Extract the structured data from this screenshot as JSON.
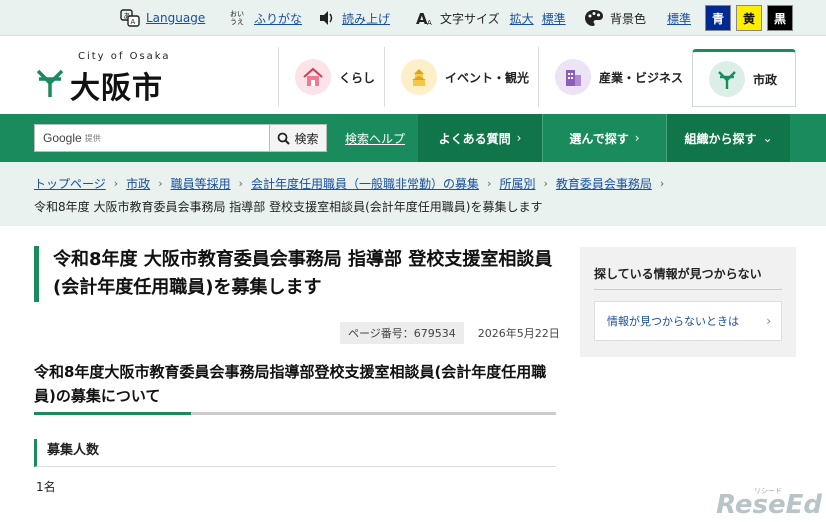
{
  "utility": {
    "language": "Language",
    "furigana_icon_text": "おいうえ",
    "furigana": "ふりがな",
    "read_aloud": "読み上げ",
    "font_size_label": "文字サイズ",
    "font_enlarge": "拡大",
    "font_standard": "標準",
    "bg_color_label": "背景色",
    "bg_standard": "標準",
    "bg_blue": "青",
    "bg_yellow": "黄",
    "bg_black": "黒"
  },
  "header": {
    "logo_small": "City of Osaka",
    "logo_name": "大阪市",
    "categories": [
      {
        "label": "くらし"
      },
      {
        "label": "イベント・観光"
      },
      {
        "label": "産業・ビジネス"
      },
      {
        "label": "市政"
      }
    ]
  },
  "nav": {
    "search_brand": "Google",
    "search_brand_sub": "提供",
    "search_button": "検索",
    "search_help": "検索ヘルプ",
    "tabs": [
      {
        "label": "よくある質問",
        "arrow": "›"
      },
      {
        "label": "選んで探す",
        "arrow": "›"
      },
      {
        "label": "組織から探す",
        "arrow": "⌄"
      }
    ]
  },
  "breadcrumb": {
    "items": [
      "トップページ",
      "市政",
      "職員等採用",
      "会計年度任用職員（一般職非常勤）の募集",
      "所属別",
      "教育委員会事務局"
    ],
    "current": "令和8年度 大阪市教育委員会事務局 指導部 登校支援室相談員(会計年度任用職員)を募集します"
  },
  "main": {
    "title": "令和8年度 大阪市教育委員会事務局 指導部 登校支援室相談員(会計年度任用職員)を募集します",
    "page_number": "ページ番号：679534",
    "date": "2026年5月22日",
    "heading2": "令和8年度大阪市教育委員会事務局指導部登校支援室相談員(会計年度任用職員)の募集について",
    "heading3": "募集人数",
    "body": "1名"
  },
  "sidebar": {
    "title": "探している情報が見つからない",
    "link": "情報が見つからないときは",
    "chevron": "›"
  },
  "watermark": {
    "small": "リシード",
    "text": "ReseEd"
  },
  "colors": {
    "brand_green": "#1a8b5c",
    "link_blue": "#1a4fa0",
    "bg_light": "#e9f2ee"
  }
}
